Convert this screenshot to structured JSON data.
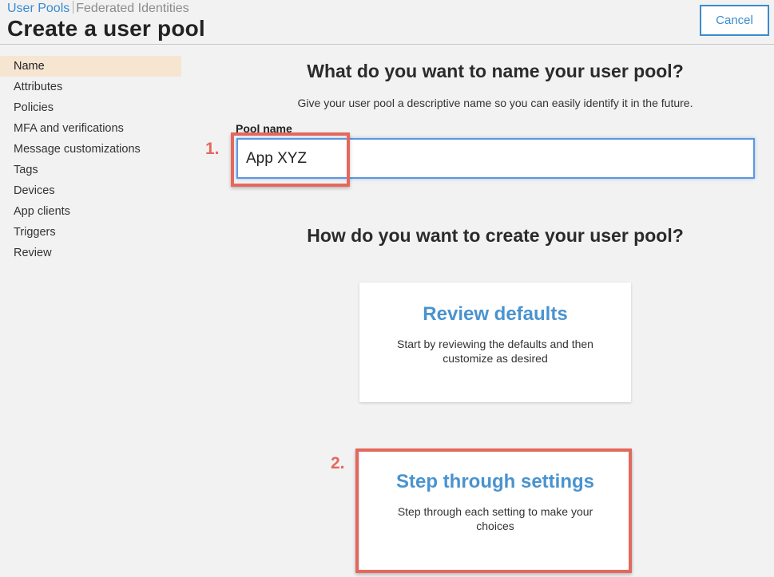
{
  "header": {
    "tabs": [
      {
        "label": "User Pools",
        "active": true
      },
      {
        "label": "Federated Identities",
        "active": false
      }
    ],
    "title": "Create a user pool",
    "cancel_label": "Cancel"
  },
  "sidebar": {
    "items": [
      {
        "label": "Name",
        "active": true
      },
      {
        "label": "Attributes"
      },
      {
        "label": "Policies"
      },
      {
        "label": "MFA and verifications"
      },
      {
        "label": "Message customizations"
      },
      {
        "label": "Tags"
      },
      {
        "label": "Devices"
      },
      {
        "label": "App clients"
      },
      {
        "label": "Triggers"
      },
      {
        "label": "Review"
      }
    ]
  },
  "main": {
    "name_heading": "What do you want to name your user pool?",
    "name_subtitle": "Give your user pool a descriptive name so you can easily identify it in the future.",
    "pool_name_label": "Pool name",
    "pool_name_value": "App XYZ",
    "create_heading": "How do you want to create your user pool?",
    "options": [
      {
        "title": "Review defaults",
        "description": "Start by reviewing the defaults and then customize as desired"
      },
      {
        "title": "Step through settings",
        "description": "Step through each setting to make your choices"
      }
    ]
  },
  "annotations": {
    "step1": "1.",
    "step2": "2.",
    "color": "#e4685c"
  },
  "colors": {
    "accent": "#3b8bd0",
    "active_nav_bg": "#f6e5d1",
    "background": "#f2f2f2"
  }
}
